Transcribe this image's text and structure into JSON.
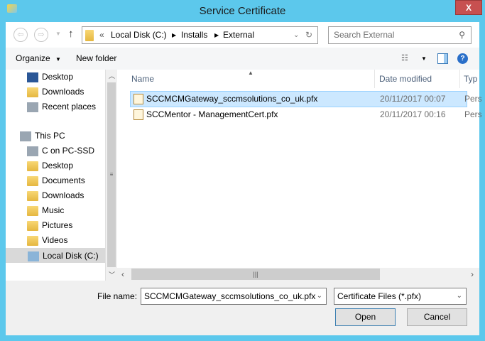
{
  "window": {
    "title": "Service Certificate",
    "close_label": "X"
  },
  "address": {
    "prefix": "«",
    "segments": [
      "Local Disk (C:)",
      "Installs",
      "External"
    ]
  },
  "search": {
    "placeholder": "Search External"
  },
  "toolbar": {
    "organize": "Organize",
    "new_folder": "New folder"
  },
  "nav": {
    "items": [
      {
        "label": "Desktop",
        "icon": "desktop-icon"
      },
      {
        "label": "Downloads",
        "icon": "downloads-folder-icon"
      },
      {
        "label": "Recent places",
        "icon": "recent-places-icon"
      },
      {
        "label": "This PC",
        "icon": "computer-icon"
      },
      {
        "label": "C on PC-SSD",
        "icon": "network-drive-icon"
      },
      {
        "label": "Desktop",
        "icon": "folder-icon"
      },
      {
        "label": "Documents",
        "icon": "folder-icon"
      },
      {
        "label": "Downloads",
        "icon": "folder-icon"
      },
      {
        "label": "Music",
        "icon": "folder-icon"
      },
      {
        "label": "Pictures",
        "icon": "folder-icon"
      },
      {
        "label": "Videos",
        "icon": "folder-icon"
      },
      {
        "label": "Local Disk (C:)",
        "icon": "drive-icon",
        "selected": true
      }
    ]
  },
  "columns": {
    "name": "Name",
    "date": "Date modified",
    "type": "Typ"
  },
  "files": [
    {
      "name": "SCCMCMGateway_sccmsolutions_co_uk.pfx",
      "date": "20/11/2017 00:07",
      "type": "Pers",
      "selected": true
    },
    {
      "name": "SCCMentor - ManagementCert.pfx",
      "date": "20/11/2017 00:16",
      "type": "Pers"
    }
  ],
  "bottom": {
    "file_name_label": "File name:",
    "file_name_value": "SCCMCMGateway_sccmsolutions_co_uk.pfx",
    "filter_value": "Certificate Files (*.pfx)",
    "open": "Open",
    "cancel": "Cancel"
  },
  "colors": {
    "frame": "#5cc8ec",
    "close": "#c75050",
    "selection": "#cce8ff"
  }
}
